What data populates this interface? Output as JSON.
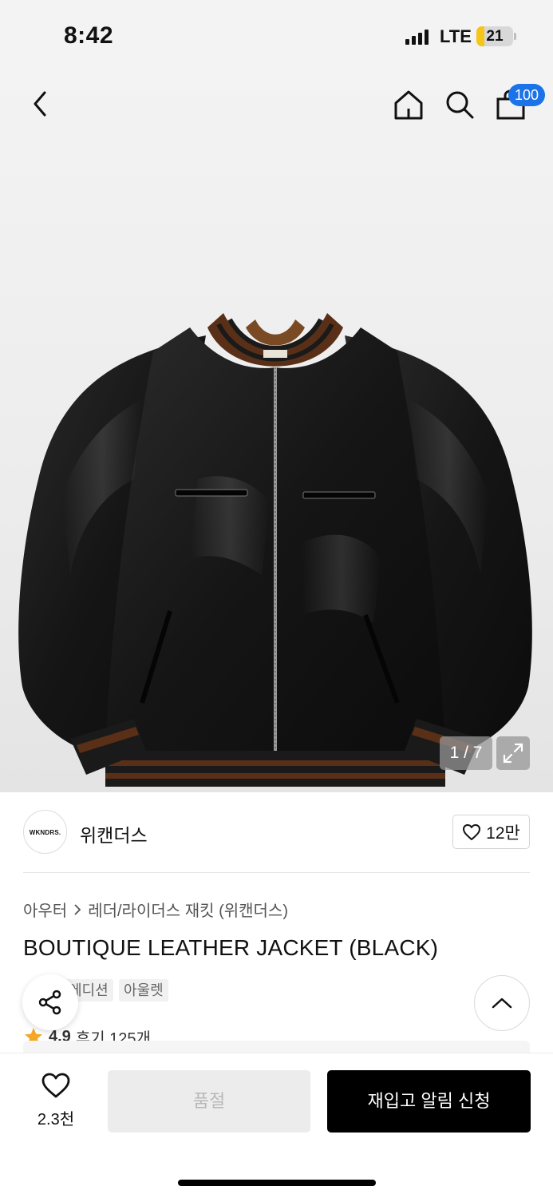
{
  "status_bar": {
    "time": "8:42",
    "network": "LTE",
    "battery_level": "21",
    "battery_fraction": 0.21,
    "battery_color": "#f5c518"
  },
  "nav": {
    "back_icon": "chevron-left-icon",
    "home_icon": "home-icon",
    "search_icon": "search-icon",
    "cart_icon": "shopping-bag-icon",
    "cart_count": "100",
    "badge_color": "#1a73e8"
  },
  "gallery": {
    "counter": "1 / 7",
    "logo_text": "WKNDRS."
  },
  "brand": {
    "logo_text": "WKNDRS.",
    "name": "위캔더스",
    "like_count": "12만"
  },
  "product": {
    "category_parent": "아우터",
    "category_child": "레더/라이더스 재킷 (위캔더스)",
    "title": "BOUTIQUE LEATHER JACKET (BLACK)",
    "tags": [
      "에디션",
      "아울렛"
    ],
    "rating": "4.9",
    "review_label": "후기 125개"
  },
  "bottom": {
    "wish_count": "2.3천",
    "soldout_label": "품절",
    "restock_label": "재입고 알림 신청"
  }
}
